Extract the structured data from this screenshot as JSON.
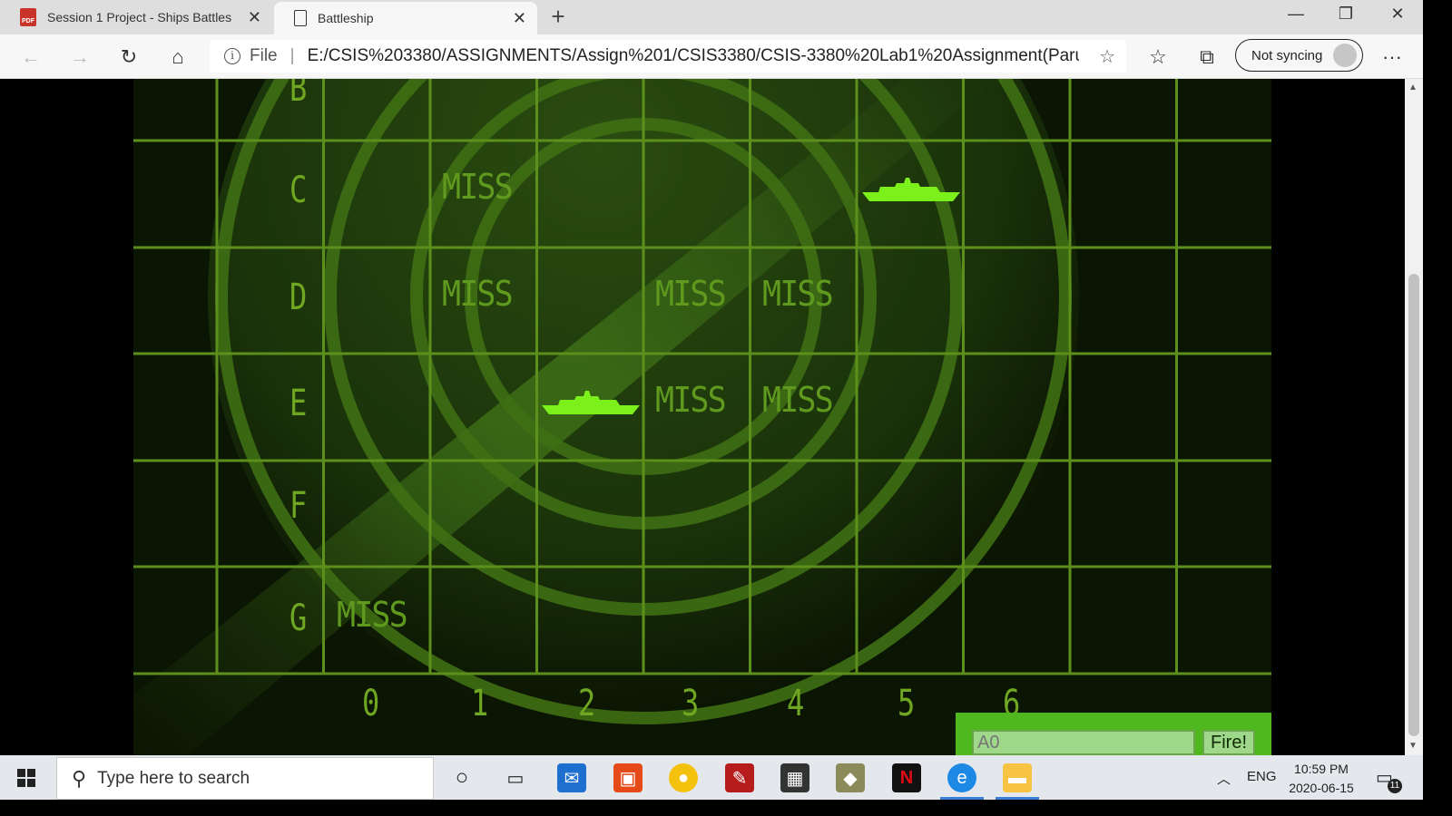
{
  "browser": {
    "tabs": [
      {
        "title": "Session 1 Project - Ships Battles",
        "icon": "pdf-icon",
        "active": false
      },
      {
        "title": "Battleship",
        "icon": "document-icon",
        "active": true
      }
    ],
    "new_tab": "+",
    "address": {
      "scheme": "File",
      "url": "E:/CSIS%203380/ASSIGNMENTS/Assign%201/CSIS3380/CSIS-3380%20Lab1%20Assignment(Paru..."
    },
    "sync_label": "Not syncing",
    "more": "···"
  },
  "game": {
    "row_labels": [
      "B",
      "C",
      "D",
      "E",
      "F",
      "G"
    ],
    "col_labels": [
      "0",
      "1",
      "2",
      "3",
      "4",
      "5",
      "6"
    ],
    "miss_text": "MISS",
    "misses": [
      {
        "row": "C",
        "col": 1
      },
      {
        "row": "D",
        "col": 1
      },
      {
        "row": "D",
        "col": 3
      },
      {
        "row": "D",
        "col": 4
      },
      {
        "row": "E",
        "col": 3
      },
      {
        "row": "E",
        "col": 4
      },
      {
        "row": "G",
        "col": 0
      }
    ],
    "hits": [
      {
        "row": "C",
        "col": 5
      },
      {
        "row": "E",
        "col": 2
      }
    ],
    "input_placeholder": "A0",
    "fire_label": "Fire!",
    "colors": {
      "grid": "#6fa622",
      "ship": "#7cf01a",
      "panel": "#4fb81e"
    }
  },
  "taskbar": {
    "search_placeholder": "Type here to search",
    "language": "ENG",
    "time": "10:59 PM",
    "date": "2020-06-15",
    "notifications": "11"
  }
}
